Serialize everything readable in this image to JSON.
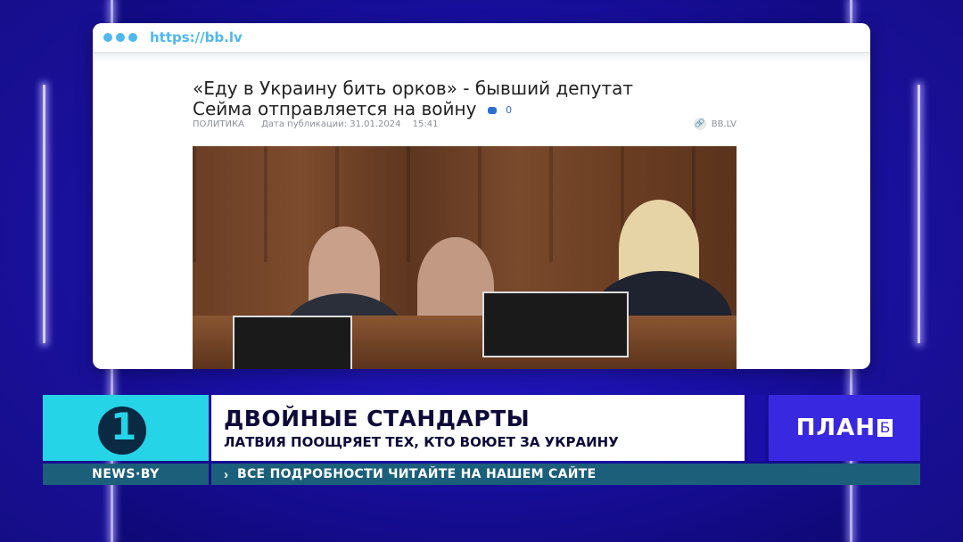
{
  "browser": {
    "url": "https://bb.lv"
  },
  "article": {
    "headline": "«Еду в Украину бить орков» - бывший депутат Сейма отправляется на войну",
    "comment_count": "0",
    "category": "ПОЛИТИКА",
    "date_label": "Дата публикации: 31.01.2024",
    "time": "15:41",
    "source": "BB.LV"
  },
  "lower_third": {
    "title": "ДВОЙНЫЕ СТАНДАРТЫ",
    "subtitle": "ЛАТВИЯ ПООЩРЯЕТ ТЕХ, КТО ВОЮЕТ ЗА УКРАИНУ",
    "channel_logo_digit": "1",
    "brand_text": "ПЛАН",
    "brand_letter": "Б"
  },
  "ticker": {
    "site": "NEWS·BY",
    "text": "ВСЕ ПОДРОБНОСТИ ЧИТАЙТЕ НА НАШЕМ САЙТЕ"
  },
  "colors": {
    "background": "#1a10a8",
    "accent_cyan": "#26d4e8",
    "brand_blue": "#3828e0",
    "ticker_bg": "#1c5f7a",
    "url_blue": "#4fb8ee"
  },
  "icons": [
    "comment-icon",
    "link-icon",
    "chevron-right-icon"
  ]
}
